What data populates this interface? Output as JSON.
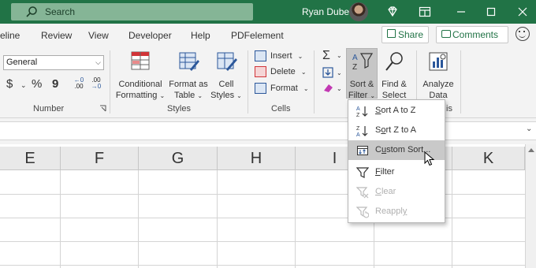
{
  "titlebar": {
    "search_placeholder": "Search",
    "user_name": "Ryan Dube",
    "bg_color": "#217346"
  },
  "tabs": [
    "eline",
    "Review",
    "View",
    "Developer",
    "Help",
    "PDFelement"
  ],
  "actions": {
    "share": "Share",
    "comments": "Comments"
  },
  "number_group": {
    "format_value": "General",
    "currency": "$",
    "percent": "%",
    "comma": "9",
    "inc_decimal_top": "←0",
    "inc_decimal_bottom": ".00",
    "dec_decimal_top": ".00",
    "dec_decimal_bottom": "→0",
    "label": "Number"
  },
  "styles_group": {
    "conditional_line1": "Conditional",
    "conditional_line2": "Formatting",
    "format_table_line1": "Format as",
    "format_table_line2": "Table",
    "cell_styles_line1": "Cell",
    "cell_styles_line2": "Styles",
    "label": "Styles"
  },
  "cells_group": {
    "insert": "Insert",
    "delete": "Delete",
    "format": "Format",
    "label": "Cells"
  },
  "editing_group": {
    "sort_filter_line1": "Sort &",
    "sort_filter_line2": "Filter",
    "find_select_line1": "Find &",
    "find_select_line2": "Select",
    "label_tail": "is"
  },
  "analysis_group": {
    "analyze_line1": "Analyze",
    "analyze_line2": "Data"
  },
  "columns": [
    "E",
    "F",
    "G",
    "H",
    "I",
    "K"
  ],
  "sort_menu": {
    "items": [
      {
        "key": "S",
        "rest": "ort A to Z",
        "icon": "sort-a-to-z-icon",
        "state": "normal"
      },
      {
        "key": "o",
        "pre": "S",
        "rest": "rt Z to A",
        "icon": "sort-z-to-a-icon",
        "state": "normal"
      },
      {
        "key": "U",
        "pre": "C",
        "rest": "stom Sort...",
        "icon": "custom-sort-icon",
        "state": "hover"
      },
      {
        "key": "F",
        "rest": "ilter",
        "icon": "filter-icon",
        "state": "normal"
      },
      {
        "key": "C",
        "rest": "lear",
        "icon": "clear-filter-icon",
        "state": "disabled"
      },
      {
        "key": "y",
        "pre": "Reappl",
        "rest": "",
        "icon": "reapply-icon",
        "state": "disabled"
      }
    ]
  }
}
